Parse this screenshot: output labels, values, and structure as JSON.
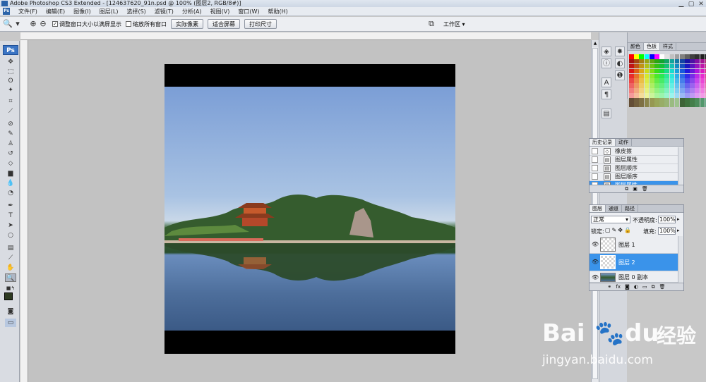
{
  "window": {
    "title": "Adobe Photoshop CS3 Extended - [124637620_91n.psd @ 100% (图层2, RGB/8#)]",
    "controls": {
      "minimize": "▁",
      "restore": "▢",
      "close": "✕"
    }
  },
  "menu": {
    "app_icon": "Ps",
    "items": [
      "文件(F)",
      "编辑(E)",
      "图像(I)",
      "图层(L)",
      "选择(S)",
      "滤镜(T)",
      "分析(A)",
      "视图(V)",
      "窗口(W)",
      "帮助(H)"
    ]
  },
  "options": {
    "resize_windows": "调整窗口大小以满屏显示",
    "zoom_all": "缩放所有窗口",
    "actual_pixels": "实际像素",
    "fit_screen": "适合屏幕",
    "print_size": "打印尺寸",
    "workspace": "工作区 ▾"
  },
  "toolbox": {
    "logo": "Ps"
  },
  "swatch_panel": {
    "tabs": [
      "颜色",
      "色板",
      "样式"
    ],
    "active_tab": "色板"
  },
  "history": {
    "tabs": [
      "历史记录",
      "动作"
    ],
    "items": [
      "橡皮擦",
      "图层属性",
      "图层顺序",
      "图层顺序",
      "图层属性"
    ],
    "selected_index": 4
  },
  "layers": {
    "tabs": [
      "图层",
      "通道",
      "路径"
    ],
    "blend_mode": "正常",
    "opacity_label": "不透明度:",
    "opacity": "100%",
    "lock_label": "锁定:",
    "fill_label": "填充:",
    "fill": "100%",
    "rows": [
      {
        "name": "图层 1"
      },
      {
        "name": "图层 2"
      },
      {
        "name": "图层 0 副本"
      }
    ],
    "selected_index": 1
  },
  "watermark": {
    "brand": "Bai",
    "brand2": "du",
    "cn": "经验",
    "url": "jingyan.baidu.com"
  },
  "colors": {
    "selection": "#3a93ea",
    "workspace_bg": "#c2c2c2",
    "ps_blue": "#3a74c4"
  }
}
